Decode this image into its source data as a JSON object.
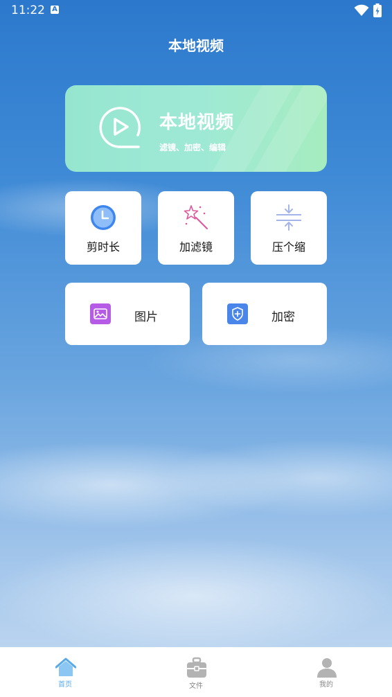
{
  "status_bar": {
    "time": "11:22",
    "notification_badge": "A"
  },
  "header": {
    "title": "本地视频"
  },
  "hero_card": {
    "title": "本地视频",
    "subtitle": "滤镜、加密、编辑"
  },
  "tools": [
    {
      "label": "剪时长",
      "icon": "clock-icon"
    },
    {
      "label": "加滤镜",
      "icon": "magic-wand-icon"
    },
    {
      "label": "压个缩",
      "icon": "compress-icon"
    }
  ],
  "wide_tools": [
    {
      "label": "图片",
      "icon": "image-icon",
      "color": "#b65be6"
    },
    {
      "label": "加密",
      "icon": "shield-plus-icon",
      "color": "#4a86ea"
    }
  ],
  "bottom_nav": [
    {
      "label": "首页",
      "icon": "home-icon",
      "active": true
    },
    {
      "label": "文件",
      "icon": "briefcase-icon",
      "active": false
    },
    {
      "label": "我的",
      "icon": "user-icon",
      "active": false
    }
  ],
  "colors": {
    "accent": "#5aa9e9",
    "hero_start": "#96e6cf",
    "hero_end": "#a6ecc0"
  }
}
